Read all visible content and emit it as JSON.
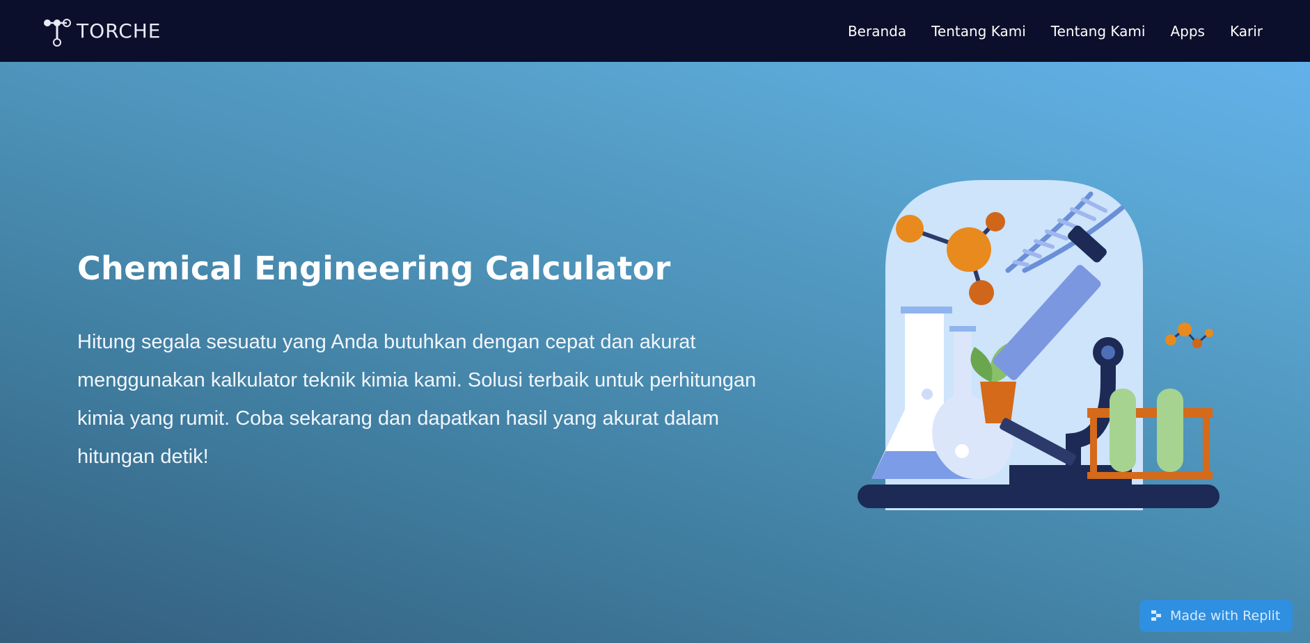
{
  "brand": {
    "name": "TORCHE"
  },
  "nav": {
    "items": [
      {
        "label": "Beranda"
      },
      {
        "label": "Tentang Kami"
      },
      {
        "label": "Tentang Kami"
      },
      {
        "label": "Apps"
      },
      {
        "label": "Karir"
      }
    ]
  },
  "hero": {
    "title": "Chemical Engineering Calculator",
    "description": "Hitung segala sesuatu yang Anda butuhkan dengan cepat dan akurat menggunakan kalkulator teknik kimia kami. Solusi terbaik untuk perhitungan kimia yang rumit. Coba sekarang dan dapatkan hasil yang akurat dalam hitungan detik!",
    "illustration_icon": "laboratory-illustration"
  },
  "badge": {
    "label": "Made with Replit",
    "icon": "replit-icon"
  },
  "colors": {
    "navbar": "#0b0f2b",
    "hero_gradient_start": "#345e7e",
    "hero_gradient_end": "#63b1ea",
    "badge": "#2f8fe0"
  }
}
